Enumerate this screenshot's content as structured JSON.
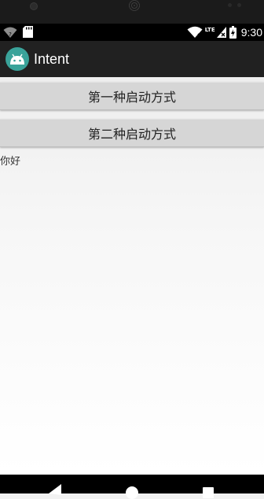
{
  "status_bar": {
    "time": "9:30",
    "network_label": "LTE",
    "icons": [
      "wifi-icon",
      "sd-card-icon",
      "wifi-icon",
      "lte-icon",
      "signal-icon",
      "battery-icon"
    ]
  },
  "app_bar": {
    "title": "Intent",
    "icon": "android-icon",
    "background": "#212121"
  },
  "main": {
    "buttons": [
      {
        "label": "第一种启动方式"
      },
      {
        "label": "第二种启动方式"
      }
    ],
    "text": "你好"
  },
  "nav_bar": {
    "icons": [
      "back-icon",
      "home-icon",
      "recents-icon"
    ]
  }
}
